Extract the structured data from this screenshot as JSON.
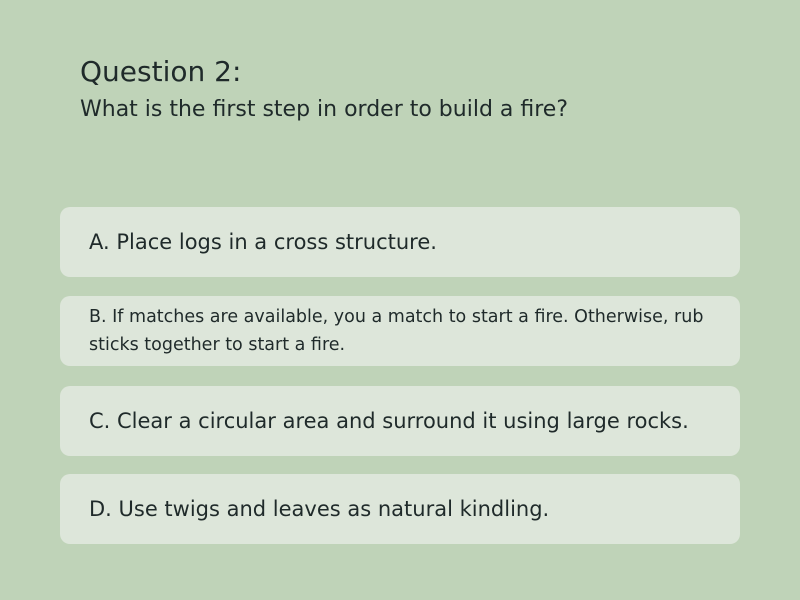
{
  "question": {
    "heading": "Question 2:",
    "text": "What is the first step in order to build a fire?"
  },
  "options": [
    {
      "text": "A. Place logs in a cross structure."
    },
    {
      "text": "B. If matches are available, you a match to start a fire. Otherwise, rub sticks together to start a fire."
    },
    {
      "text": "C. Clear a circular area and surround it using large rocks."
    },
    {
      "text": "D. Use twigs and leaves as natural kindling."
    }
  ],
  "colors": {
    "background": "#bfd3b8",
    "option_background": "#dde6da",
    "text": "#1f2a2a"
  }
}
